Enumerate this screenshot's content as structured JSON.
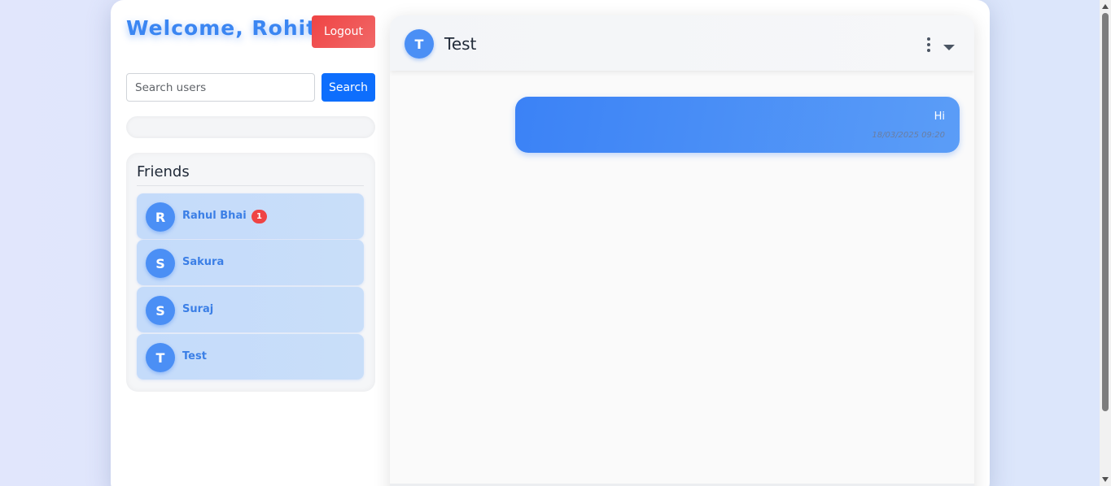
{
  "sidebar": {
    "welcome": "Welcome, Rohit",
    "logout_label": "Logout",
    "search": {
      "placeholder": "Search users",
      "value": "",
      "button_label": "Search"
    },
    "friends": {
      "title": "Friends",
      "items": [
        {
          "initial": "R",
          "name": "Rahul Bhai",
          "unread": "1"
        },
        {
          "initial": "S",
          "name": "Sakura",
          "unread": ""
        },
        {
          "initial": "S",
          "name": "Suraj",
          "unread": ""
        },
        {
          "initial": "T",
          "name": "Test",
          "unread": ""
        }
      ]
    }
  },
  "chat": {
    "contact_initial": "T",
    "contact_name": "Test",
    "icons": {
      "menu": "vertical-dots-icon",
      "dropdown": "caret-down-icon"
    },
    "messages": [
      {
        "text": "Hi",
        "time": "18/03/2025 09:20",
        "sent": true
      }
    ]
  },
  "colors": {
    "accent": "#3b82f6",
    "button_primary": "#0d6efd",
    "logout": "#ef4444",
    "badge": "#ef4444"
  }
}
